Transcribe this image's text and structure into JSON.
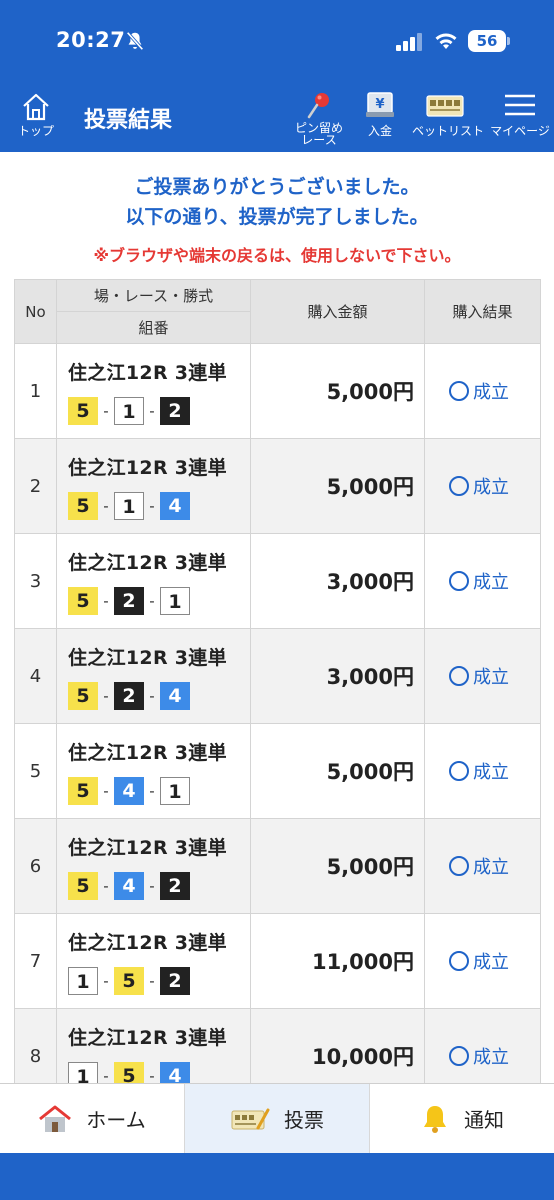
{
  "status": {
    "time": "20:27",
    "battery": "56"
  },
  "header": {
    "home_label": "トップ",
    "title": "投票結果",
    "pin_label_1": "ピン留め",
    "pin_label_2": "レース",
    "deposit_label": "入金",
    "betlist_label": "ベットリスト",
    "mypage_label": "マイページ"
  },
  "messages": {
    "line1": "ご投票ありがとうございました。",
    "line2": "以下の通り、投票が完了しました。",
    "warning": "※ブラウザや端末の戻るは、使用しないで下さい。"
  },
  "table": {
    "headers": {
      "no": "No",
      "race": "場・レース・勝式",
      "combo": "組番",
      "amount": "購入金額",
      "result": "購入結果"
    },
    "rows": [
      {
        "no": "1",
        "race": "住之江12R 3連単",
        "combo": [
          "5",
          "1",
          "2"
        ],
        "amount": "5,000円",
        "result": "成立"
      },
      {
        "no": "2",
        "race": "住之江12R 3連単",
        "combo": [
          "5",
          "1",
          "4"
        ],
        "amount": "5,000円",
        "result": "成立"
      },
      {
        "no": "3",
        "race": "住之江12R 3連単",
        "combo": [
          "5",
          "2",
          "1"
        ],
        "amount": "3,000円",
        "result": "成立"
      },
      {
        "no": "4",
        "race": "住之江12R 3連単",
        "combo": [
          "5",
          "2",
          "4"
        ],
        "amount": "3,000円",
        "result": "成立"
      },
      {
        "no": "5",
        "race": "住之江12R 3連単",
        "combo": [
          "5",
          "4",
          "1"
        ],
        "amount": "5,000円",
        "result": "成立"
      },
      {
        "no": "6",
        "race": "住之江12R 3連単",
        "combo": [
          "5",
          "4",
          "2"
        ],
        "amount": "5,000円",
        "result": "成立"
      },
      {
        "no": "7",
        "race": "住之江12R 3連単",
        "combo": [
          "1",
          "5",
          "2"
        ],
        "amount": "11,000円",
        "result": "成立"
      },
      {
        "no": "8",
        "race": "住之江12R 3連単",
        "combo": [
          "1",
          "5",
          "4"
        ],
        "amount": "10,000円",
        "result": "成立"
      }
    ],
    "combo_separator": "-"
  },
  "tabbar": {
    "home": "ホーム",
    "vote": "投票",
    "notify": "通知"
  },
  "colors": {
    "brand": "#1f63c8",
    "warning": "#e53935",
    "boat": {
      "1": "#ffffff",
      "2": "#222222",
      "3": "#e53935",
      "4": "#3d8be8",
      "5": "#f7e14b",
      "6": "#1faa4d"
    }
  }
}
